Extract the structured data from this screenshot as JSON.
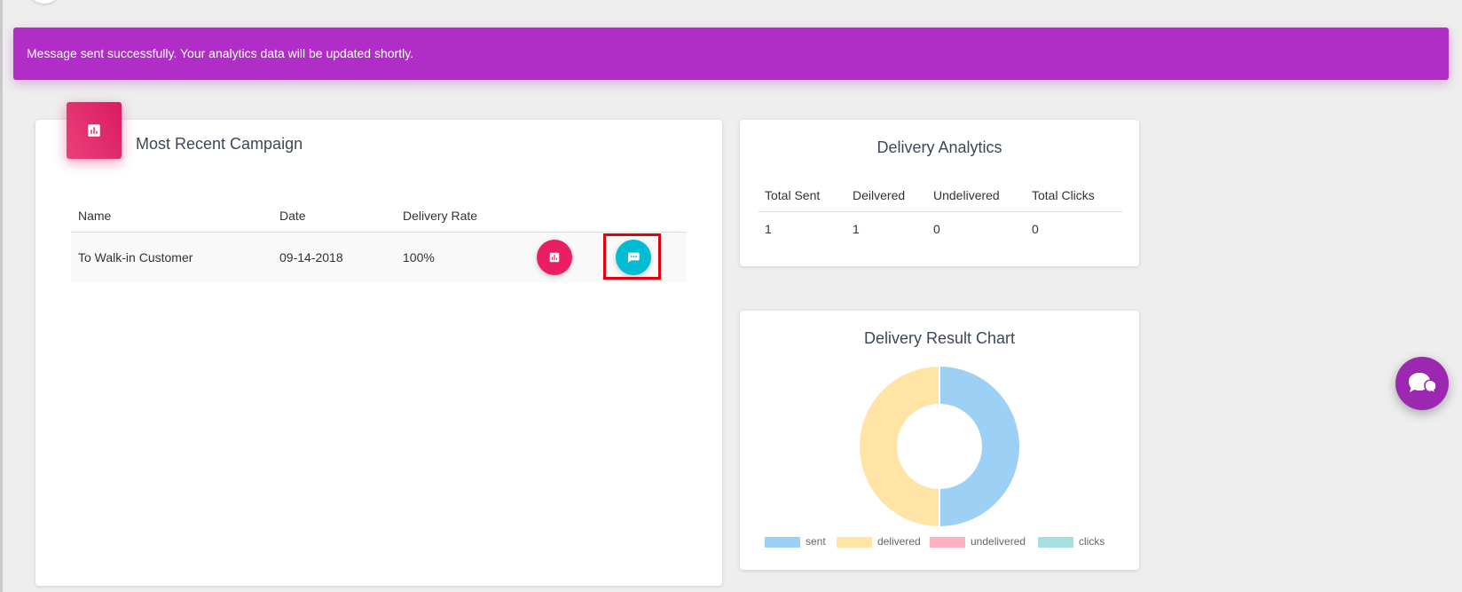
{
  "banner": {
    "message": "Message sent successfully. Your analytics data will be updated shortly."
  },
  "campaign": {
    "title": "Most Recent Campaign",
    "icon": "bar-chart-icon",
    "columns": [
      "Name",
      "Date",
      "Delivery Rate"
    ],
    "rows": [
      {
        "name": "To Walk-in Customer",
        "date": "09-14-2018",
        "rate": "100%"
      }
    ],
    "actions": {
      "analytics_icon": "bar-chart-icon",
      "message_icon": "chat-bubble-icon"
    }
  },
  "analytics": {
    "title": "Delivery Analytics",
    "columns": [
      "Total Sent",
      "Deilvered",
      "Undelivered",
      "Total Clicks"
    ],
    "values": [
      "1",
      "1",
      "0",
      "0"
    ]
  },
  "chart": {
    "title": "Delivery Result Chart"
  },
  "chart_data": {
    "type": "pie",
    "title": "Delivery Result Chart",
    "categories": [
      "sent",
      "delivered",
      "undelivered",
      "clicks"
    ],
    "values": [
      1,
      1,
      0,
      0
    ],
    "colors": [
      "#9dd0f5",
      "#ffe4a6",
      "#ffb1c1",
      "#a5dfdf"
    ],
    "donut": true,
    "legend_position": "bottom"
  },
  "colors": {
    "banner": "#b12dc7",
    "accent_pink": "#e91e63",
    "accent_cyan": "#00bcd4",
    "chat_fab": "#9c27b0",
    "highlight": "#e0000f"
  },
  "chat_fab": {
    "icon": "chat-bubbles-icon"
  }
}
